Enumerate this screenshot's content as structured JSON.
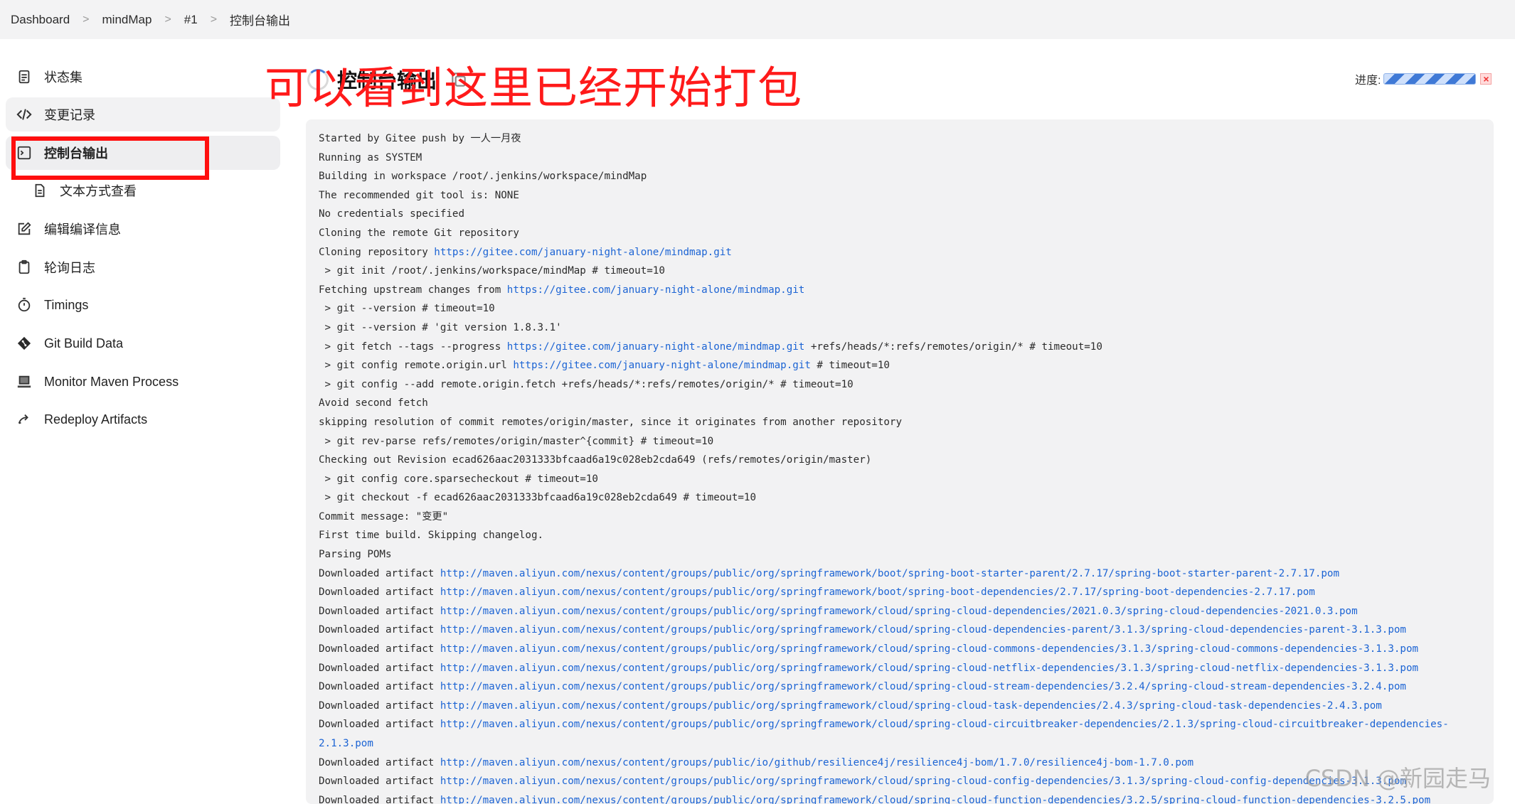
{
  "breadcrumb": {
    "items": [
      "Dashboard",
      "mindMap",
      "#1",
      "控制台输出"
    ],
    "separator": ">"
  },
  "sidebar": {
    "items": [
      {
        "label": "状态集",
        "icon": "document-icon"
      },
      {
        "label": "变更记录",
        "icon": "code-icon"
      },
      {
        "label": "控制台输出",
        "icon": "terminal-icon"
      },
      {
        "label": "文本方式查看",
        "icon": "document-icon"
      },
      {
        "label": "编辑编译信息",
        "icon": "edit-icon"
      },
      {
        "label": "轮询日志",
        "icon": "clipboard-icon"
      },
      {
        "label": "Timings",
        "icon": "stopwatch-icon"
      },
      {
        "label": "Git Build Data",
        "icon": "git-icon"
      },
      {
        "label": "Monitor Maven Process",
        "icon": "computer-icon"
      },
      {
        "label": "Redeploy Artifacts",
        "icon": "redeploy-icon"
      }
    ]
  },
  "page": {
    "title": "控制台输出",
    "annotation": "可以看到这里已经开始打包",
    "progress_label": "进度:",
    "watermark": "CSDN @新园走马"
  },
  "colors": {
    "accent": "#1c64d4",
    "annotation": "#ff1a1a",
    "console_bg": "#f2f2f3"
  },
  "console": {
    "lines": [
      {
        "text": "Started by Gitee push by 一人一月夜"
      },
      {
        "text": "Running as SYSTEM"
      },
      {
        "text": "Building in workspace /root/.jenkins/workspace/mindMap"
      },
      {
        "text": "The recommended git tool is: NONE"
      },
      {
        "text": "No credentials specified"
      },
      {
        "text": "Cloning the remote Git repository"
      },
      {
        "text": "Cloning repository ",
        "link": "https://gitee.com/january-night-alone/mindmap.git"
      },
      {
        "text": " > git init /root/.jenkins/workspace/mindMap # timeout=10"
      },
      {
        "text": "Fetching upstream changes from ",
        "link": "https://gitee.com/january-night-alone/mindmap.git"
      },
      {
        "text": " > git --version # timeout=10"
      },
      {
        "text": " > git --version # 'git version 1.8.3.1'"
      },
      {
        "text": " > git fetch --tags --progress ",
        "link": "https://gitee.com/january-night-alone/mindmap.git",
        "after": " +refs/heads/*:refs/remotes/origin/* # timeout=10"
      },
      {
        "text": " > git config remote.origin.url ",
        "link": "https://gitee.com/january-night-alone/mindmap.git",
        "after": " # timeout=10"
      },
      {
        "text": " > git config --add remote.origin.fetch +refs/heads/*:refs/remotes/origin/* # timeout=10"
      },
      {
        "text": "Avoid second fetch"
      },
      {
        "text": "skipping resolution of commit remotes/origin/master, since it originates from another repository"
      },
      {
        "text": " > git rev-parse refs/remotes/origin/master^{commit} # timeout=10"
      },
      {
        "text": "Checking out Revision ecad626aac2031333bfcaad6a19c028eb2cda649 (refs/remotes/origin/master)"
      },
      {
        "text": " > git config core.sparsecheckout # timeout=10"
      },
      {
        "text": " > git checkout -f ecad626aac2031333bfcaad6a19c028eb2cda649 # timeout=10"
      },
      {
        "text": "Commit message: \"变更\""
      },
      {
        "text": "First time build. Skipping changelog."
      },
      {
        "text": "Parsing POMs"
      },
      {
        "text": "Downloaded artifact ",
        "link": "http://maven.aliyun.com/nexus/content/groups/public/org/springframework/boot/spring-boot-starter-parent/2.7.17/spring-boot-starter-parent-2.7.17.pom"
      },
      {
        "text": "Downloaded artifact ",
        "link": "http://maven.aliyun.com/nexus/content/groups/public/org/springframework/boot/spring-boot-dependencies/2.7.17/spring-boot-dependencies-2.7.17.pom"
      },
      {
        "text": "Downloaded artifact ",
        "link": "http://maven.aliyun.com/nexus/content/groups/public/org/springframework/cloud/spring-cloud-dependencies/2021.0.3/spring-cloud-dependencies-2021.0.3.pom"
      },
      {
        "text": "Downloaded artifact ",
        "link": "http://maven.aliyun.com/nexus/content/groups/public/org/springframework/cloud/spring-cloud-dependencies-parent/3.1.3/spring-cloud-dependencies-parent-3.1.3.pom"
      },
      {
        "text": "Downloaded artifact ",
        "link": "http://maven.aliyun.com/nexus/content/groups/public/org/springframework/cloud/spring-cloud-commons-dependencies/3.1.3/spring-cloud-commons-dependencies-3.1.3.pom"
      },
      {
        "text": "Downloaded artifact ",
        "link": "http://maven.aliyun.com/nexus/content/groups/public/org/springframework/cloud/spring-cloud-netflix-dependencies/3.1.3/spring-cloud-netflix-dependencies-3.1.3.pom"
      },
      {
        "text": "Downloaded artifact ",
        "link": "http://maven.aliyun.com/nexus/content/groups/public/org/springframework/cloud/spring-cloud-stream-dependencies/3.2.4/spring-cloud-stream-dependencies-3.2.4.pom"
      },
      {
        "text": "Downloaded artifact ",
        "link": "http://maven.aliyun.com/nexus/content/groups/public/org/springframework/cloud/spring-cloud-task-dependencies/2.4.3/spring-cloud-task-dependencies-2.4.3.pom"
      },
      {
        "text": "Downloaded artifact ",
        "link": "http://maven.aliyun.com/nexus/content/groups/public/org/springframework/cloud/spring-cloud-circuitbreaker-dependencies/2.1.3/spring-cloud-circuitbreaker-dependencies-"
      },
      {
        "text": "",
        "link": "2.1.3.pom"
      },
      {
        "text": "Downloaded artifact ",
        "link": "http://maven.aliyun.com/nexus/content/groups/public/io/github/resilience4j/resilience4j-bom/1.7.0/resilience4j-bom-1.7.0.pom"
      },
      {
        "text": "Downloaded artifact ",
        "link": "http://maven.aliyun.com/nexus/content/groups/public/org/springframework/cloud/spring-cloud-config-dependencies/3.1.3/spring-cloud-config-dependencies-3.1.3.pom"
      },
      {
        "text": "Downloaded artifact ",
        "link": "http://maven.aliyun.com/nexus/content/groups/public/org/springframework/cloud/spring-cloud-function-dependencies/3.2.5/spring-cloud-function-dependencies-3.2.5.pom"
      }
    ]
  }
}
